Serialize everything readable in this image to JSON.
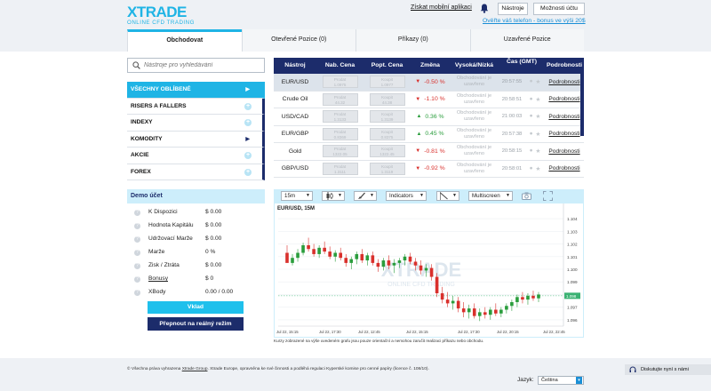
{
  "header": {
    "logo": "XTRADE",
    "logo_sub": "ONLINE CFD TRADING",
    "mobile_link": "Získat mobilní aplikaci",
    "tools_button": "Nástroje",
    "account_button": "Možnosti účtu",
    "verify_link": "Ověřte váš telefon - bonus ve výši 20$"
  },
  "tabs": [
    {
      "label": "Obchodovat"
    },
    {
      "label": "Otevřené Pozice (0)"
    },
    {
      "label": "Příkazy (0)"
    },
    {
      "label": "Uzavřené Pozice"
    }
  ],
  "search": {
    "placeholder": "Nástroje pro vyhledávání"
  },
  "categories": [
    {
      "label": "VŠECHNY OBLÍBENÉ",
      "marker": "▶"
    },
    {
      "label": "RISERS A FALLERS",
      "marker": "+"
    },
    {
      "label": "INDEXY",
      "marker": "+"
    },
    {
      "label": "KOMODITY",
      "marker": "▶"
    },
    {
      "label": "AKCIE",
      "marker": "+"
    },
    {
      "label": "FOREX",
      "marker": "+"
    }
  ],
  "demo": {
    "title": "Demo účet",
    "rows": [
      {
        "label": "K Dispozici",
        "value": "$ 0.00"
      },
      {
        "label": "Hodnota Kapitálu",
        "value": "$ 0.00"
      },
      {
        "label": "Udržovací Marže",
        "value": "$ 0.00"
      },
      {
        "label": "Marže",
        "value": "0 %"
      },
      {
        "label": "Zisk / Ztráta",
        "value": "$ 0.00"
      },
      {
        "label": "Bonusy",
        "value": "$ 0"
      },
      {
        "label": "XBody",
        "value": "0.00 / 0.00"
      }
    ],
    "deposit_button": "Vklad",
    "real_button": "Přepnout na reálný režim"
  },
  "table": {
    "headers": {
      "symbol": "Nástroj",
      "sell": "Nab. Cena",
      "buy": "Popt. Cena",
      "change": "Změna",
      "highlow": "Vysoká/Nízká",
      "time": "Čas (GMT)",
      "details": "Podrobnosti"
    },
    "rows": [
      {
        "symbol": "EUR/USD",
        "sell_label": "Prodat",
        "sell": "1.0975",
        "buy_label": "Koupit",
        "buy": "1.0977",
        "dir": "down",
        "change": "-0.50 %",
        "hl": "Obchodování je uzavřeno",
        "time": "20:57:55",
        "details": "Podrobnosti"
      },
      {
        "symbol": "Crude Oil",
        "sell_label": "Prodat",
        "sell": "44.32",
        "buy_label": "Koupit",
        "buy": "44.38",
        "dir": "down",
        "change": "-1.10 %",
        "hl": "Obchodování je uzavřeno",
        "time": "20:58:51",
        "details": "Podrobnosti"
      },
      {
        "symbol": "USD/CAD",
        "sell_label": "Prodat",
        "sell": "1.3133",
        "buy_label": "Koupit",
        "buy": "1.3139",
        "dir": "up",
        "change": "0.36 %",
        "hl": "Obchodování je uzavřeno",
        "time": "21:00:03",
        "details": "Podrobnosti"
      },
      {
        "symbol": "EUR/GBP",
        "sell_label": "Prodat",
        "sell": "0.8369",
        "buy_label": "Koupit",
        "buy": "0.8375",
        "dir": "up",
        "change": "0.45 %",
        "hl": "Obchodování je uzavřeno",
        "time": "20:57:38",
        "details": "Podrobnosti"
      },
      {
        "symbol": "Gold",
        "sell_label": "Prodat",
        "sell": "1322.05",
        "buy_label": "Koupit",
        "buy": "1322.45",
        "dir": "down",
        "change": "-0.81 %",
        "hl": "Obchodování je uzavřeno",
        "time": "20:58:15",
        "details": "Podrobnosti"
      },
      {
        "symbol": "GBP/USD",
        "sell_label": "Prodat",
        "sell": "1.3111",
        "buy_label": "Koupit",
        "buy": "1.3119",
        "dir": "down",
        "change": "-0.92 %",
        "hl": "Obchodování je uzavřeno",
        "time": "20:58:01",
        "details": "Podrobnosti"
      }
    ]
  },
  "chart_toolbar": {
    "interval": "15m",
    "indicators": "Indicators",
    "multiscreen": "Multiscreen"
  },
  "chart_data": {
    "type": "candlestick",
    "title": "EUR/USD, 15M",
    "watermark": "XTRADE",
    "watermark_sub": "ONLINE CFD TRADING",
    "ylim": [
      1.0955,
      1.1045
    ],
    "yticks": [
      "1.104",
      "1.103",
      "1.102",
      "1.101",
      "1.100",
      "1.099",
      "1.098",
      "1.097",
      "1.096"
    ],
    "ytick_values": [
      1.104,
      1.103,
      1.102,
      1.101,
      1.1,
      1.099,
      1.098,
      1.097,
      1.096
    ],
    "last_price": "1.098",
    "last_value": 1.0979,
    "xticks": [
      "Jul 22, 15:15",
      "Jul 22, 17:30",
      "Jul 22, 12:45",
      "Jul 22, 15:15",
      "Jul 22, 17:30",
      "Jul 22, 20:15",
      "Jul 22, 22:45"
    ],
    "candles": [
      [
        1.1013,
        1.1019,
        1.1008,
        1.1005
      ],
      [
        1.1005,
        1.1012,
        1.1003,
        1.1009
      ],
      [
        1.1009,
        1.1016,
        1.1006,
        1.1013
      ],
      [
        1.1013,
        1.1021,
        1.1011,
        1.1019
      ],
      [
        1.1019,
        1.1025,
        1.1014,
        1.1016
      ],
      [
        1.1016,
        1.102,
        1.101,
        1.1012
      ],
      [
        1.1012,
        1.1019,
        1.1009,
        1.1017
      ],
      [
        1.1017,
        1.1022,
        1.1012,
        1.1014
      ],
      [
        1.1014,
        1.1018,
        1.1008,
        1.101
      ],
      [
        1.101,
        1.1015,
        1.1006,
        1.1013
      ],
      [
        1.1013,
        1.1017,
        1.1007,
        1.1009
      ],
      [
        1.1009,
        1.1012,
        1.1002,
        1.1005
      ],
      [
        1.1005,
        1.101,
        1.1,
        1.1008
      ],
      [
        1.1008,
        1.1014,
        1.1004,
        1.1012
      ],
      [
        1.1012,
        1.1016,
        1.1005,
        1.1007
      ],
      [
        1.1007,
        1.1013,
        1.1003,
        1.1011
      ],
      [
        1.1011,
        1.1014,
        1.1003,
        1.1005
      ],
      [
        1.1005,
        1.1008,
        1.0998,
        1.1002
      ],
      [
        1.1002,
        1.1009,
        1.0999,
        1.1007
      ],
      [
        1.1007,
        1.1011,
        1.1,
        1.1003
      ],
      [
        1.1003,
        1.1008,
        1.0997,
        1.1005
      ],
      [
        1.1005,
        1.1009,
        1.1001,
        1.1007
      ],
      [
        1.1007,
        1.1012,
        1.1003,
        1.101
      ],
      [
        1.101,
        1.1013,
        1.1004,
        1.1006
      ],
      [
        1.1006,
        1.1009,
        1.0999,
        1.1003
      ],
      [
        1.1003,
        1.1007,
        1.0996,
        1.0999
      ],
      [
        1.0999,
        1.1004,
        1.0994,
        1.1001
      ],
      [
        1.1001,
        1.1004,
        1.0991,
        1.0994
      ],
      [
        1.0994,
        1.0997,
        1.0978,
        1.0981
      ],
      [
        1.0981,
        1.0986,
        1.0973,
        1.0976
      ],
      [
        1.0976,
        1.0982,
        1.097,
        1.0973
      ],
      [
        1.0973,
        1.0979,
        1.0968,
        1.0975
      ],
      [
        1.0975,
        1.0978,
        1.0966,
        1.0969
      ],
      [
        1.0969,
        1.0974,
        1.0962,
        1.0966
      ],
      [
        1.0966,
        1.0972,
        1.0961,
        1.0969
      ],
      [
        1.0969,
        1.0973,
        1.0961,
        1.0963
      ],
      [
        1.0963,
        1.0969,
        1.0959,
        1.0966
      ],
      [
        1.0966,
        1.097,
        1.0961,
        1.0964
      ],
      [
        1.0964,
        1.097,
        1.096,
        1.0968
      ],
      [
        1.0968,
        1.0973,
        1.0963,
        1.0965
      ],
      [
        1.0965,
        1.097,
        1.0962,
        1.0968
      ],
      [
        1.0968,
        1.0973,
        1.0965,
        1.0971
      ],
      [
        1.0971,
        1.0976,
        1.0967,
        1.0974
      ],
      [
        1.0974,
        1.098,
        1.097,
        1.0978
      ],
      [
        1.0978,
        1.0982,
        1.0973,
        1.0976
      ],
      [
        1.0976,
        1.0981,
        1.0972,
        1.0979
      ],
      [
        1.0979,
        1.0983,
        1.0975,
        1.0977
      ],
      [
        1.0977,
        1.0982,
        1.0974,
        1.098
      ]
    ]
  },
  "disclaimer": "Kurzy zobrazené na výše uvedeném grafu jsou pouze orientační a nemohou zaručit realizaci příkazu nebo obchodu.",
  "footer": {
    "copyright_pre": "© Všechna práva vyhrazena",
    "copyright_link": "Xtrade Group",
    "copyright_post": ". Xtrade Europe, opravněna ke své činnosti a podléhá regulaci Kyperské komise pro cenné papíry (licence č. 108/10).",
    "lang_label": "Jazyk:",
    "lang_value": "Čeština",
    "chat_button": "Diskutujte nyní s námi"
  },
  "colors": {
    "accent": "#1fb4e5",
    "navy": "#1c2c6b",
    "up": "#2a9d3c",
    "down": "#d9302c"
  }
}
